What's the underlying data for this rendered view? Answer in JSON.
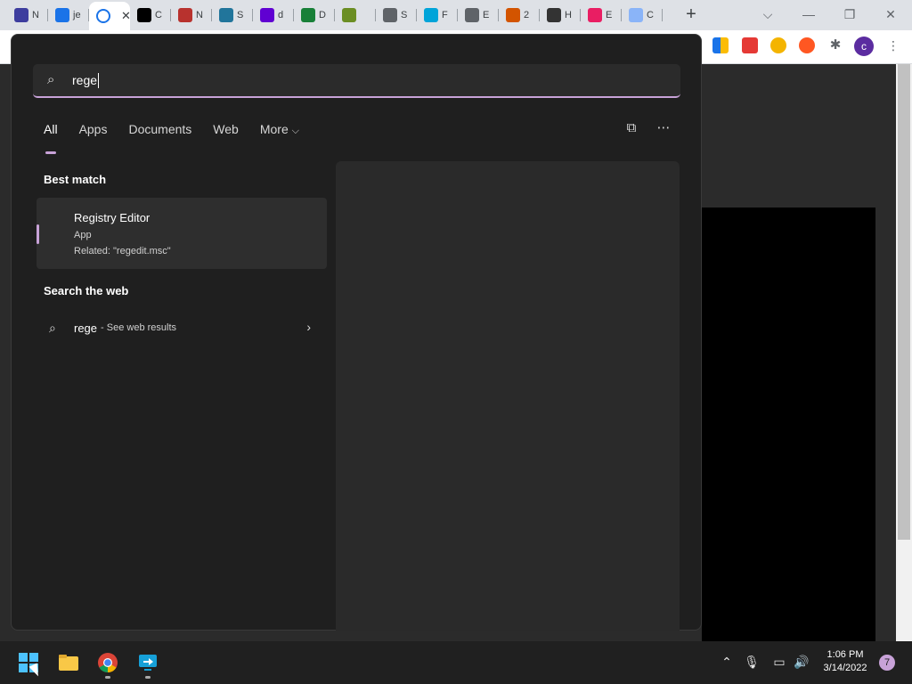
{
  "browser": {
    "tabs": [
      {
        "letter": "N",
        "color": "#3d3d9e"
      },
      {
        "letter": "je",
        "color": "#1a73e8"
      },
      {
        "letter": "",
        "color": "#1a73e8"
      },
      {
        "letter": "C",
        "color": "#000000"
      },
      {
        "letter": "N",
        "color": "#b8322e"
      },
      {
        "letter": "S",
        "color": "#21759b"
      },
      {
        "letter": "d",
        "color": "#6001d2"
      },
      {
        "letter": "D",
        "color": "#188038"
      },
      {
        "letter": "",
        "color": "#6b8e23"
      },
      {
        "letter": "S",
        "color": "#5f6368"
      },
      {
        "letter": "F",
        "color": "#00a4d9"
      },
      {
        "letter": "E",
        "color": "#5f6368"
      },
      {
        "letter": "2",
        "color": "#d35400"
      },
      {
        "letter": "H",
        "color": "#333333"
      },
      {
        "letter": "E",
        "color": "#e91e63"
      },
      {
        "letter": "C",
        "color": "#8ab4f8"
      }
    ],
    "new_tab": "+",
    "window_controls": {
      "dropdown": "⌵",
      "minimize": "—",
      "restore": "❐",
      "close": "✕"
    },
    "profile_initial": "c",
    "menu": "⋮"
  },
  "search": {
    "query": "rege",
    "filters": [
      "All",
      "Apps",
      "Documents",
      "Web",
      "More"
    ],
    "more_chevron": "⌵",
    "best_match_heading": "Best match",
    "best_match": {
      "title": "Registry Editor",
      "type": "App",
      "related": "Related: \"regedit.msc\""
    },
    "web_heading": "Search the web",
    "web_result": {
      "query": "rege",
      "suffix": " - See web results"
    }
  },
  "taskbar": {
    "time": "1:06 PM",
    "date": "3/14/2022",
    "notification_count": "7"
  }
}
